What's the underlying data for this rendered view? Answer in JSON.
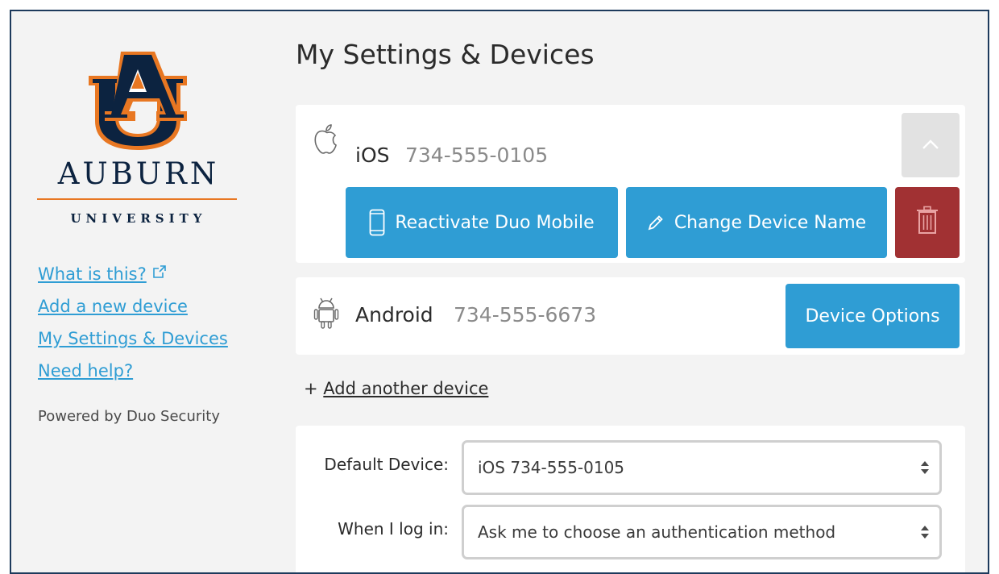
{
  "sidebar": {
    "logo": {
      "wordmark": "AUBURN",
      "subtitle": "UNIVERSITY",
      "mark_letters": "AU"
    },
    "links": [
      {
        "label": "What is this?",
        "icon": "external-link-icon"
      },
      {
        "label": "Add a new device"
      },
      {
        "label": "My Settings & Devices"
      },
      {
        "label": "Need help?"
      }
    ],
    "powered_by": "Powered by Duo Security"
  },
  "main": {
    "title": "My Settings & Devices",
    "devices": [
      {
        "type": "iOS",
        "number": "734-555-0105",
        "icon": "apple-icon",
        "expanded": true,
        "actions": {
          "reactivate": "Reactivate Duo Mobile",
          "rename": "Change Device Name"
        }
      },
      {
        "type": "Android",
        "number": "734-555-6673",
        "icon": "android-icon",
        "options_label": "Device Options"
      }
    ],
    "add_prefix": "+",
    "add_label": "Add another device",
    "settings": {
      "default_device_label": "Default Device:",
      "default_device_value": "iOS 734-555-0105",
      "login_label": "When I log in:",
      "login_value": "Ask me to choose an authentication method"
    }
  },
  "colors": {
    "accent_blue": "#2f9dd4",
    "danger_red": "#a13133",
    "auburn_navy": "#0c2340",
    "auburn_orange": "#e87722",
    "frame_border": "#1d3a5c"
  }
}
